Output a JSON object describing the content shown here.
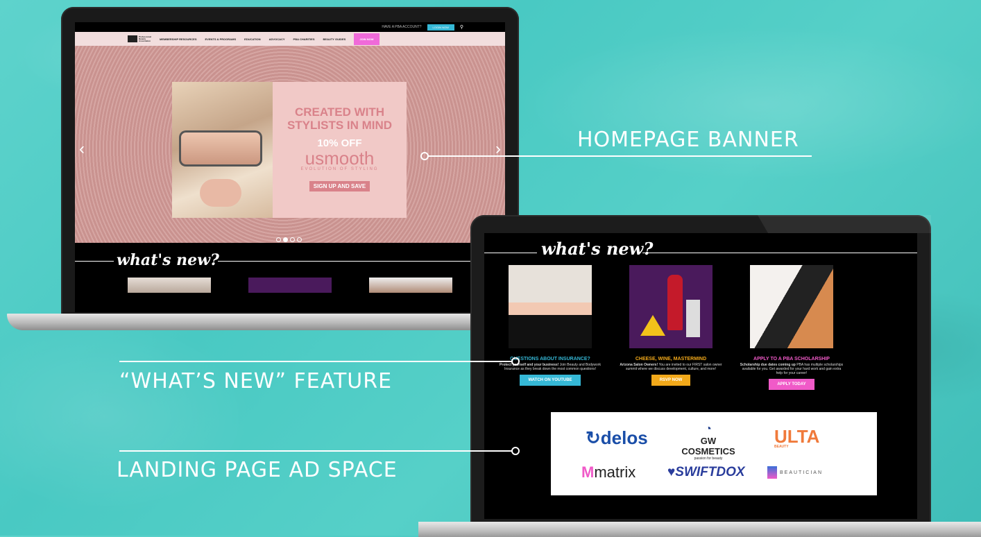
{
  "callouts": {
    "homepage_banner": "HOMEPAGE BANNER",
    "whats_new": "“WHAT’S NEW” FEATURE",
    "ad_space": "LANDING PAGE AD SPACE"
  },
  "site": {
    "topbar": {
      "account_text": "HAVE A PBA ACCOUNT?",
      "login": "LOGIN NOW"
    },
    "logo_text": "Professional Beauty Association",
    "nav": [
      "MEMBERSHIP RESOURCES",
      "EVENTS & PROGRAMS",
      "EDUCATION",
      "ADVOCACY",
      "PBA CHARITIES",
      "BEAUTY GUIDES"
    ],
    "join": "JOIN NOW",
    "banner": {
      "headline1": "CREATED WITH",
      "headline2": "STYLISTS IN MIND",
      "discount": "10% OFF",
      "brand": "usmooth",
      "tagline": "EVOLUTION OF STYLING",
      "cta": "SIGN UP AND SAVE"
    },
    "whats_new_title": "what's new?"
  },
  "cards": [
    {
      "heading": "QUESTIONS ABOUT INSURANCE?",
      "body_bold": "Protect yourself and your business!",
      "body": "Join Beauty and Bodywork Insurance as they break down the most common questions!",
      "button": "WATCH ON YOUTUBE",
      "color": "#35b8d6"
    },
    {
      "heading": "CHEESE, WINE, MASTERMIND",
      "body_bold": "Arizona Salon Owners!",
      "body": "You are invited to our FIRST salon owner summit where we discuss development, culture, and more!",
      "button": "RSVP NOW",
      "color": "#f2a91a"
    },
    {
      "heading": "APPLY TO A PBA SCHOLARSHIP",
      "body_bold": "Scholarship due dates coming up",
      "body": "PBA has multiple scholarships available for you. Get awarded for your hard work and gain extra help for your career!",
      "button": "APPLY TODAY",
      "color": "#f05ac8"
    }
  ],
  "ads": {
    "delos": "delos",
    "gw": "GW COSMETICS",
    "gw_sub": "passion for beauty",
    "ulta": "ULTA",
    "ulta_sub": "BEAUTY",
    "matrix": "matrix",
    "swiftdox": "SWIFTDOX",
    "beautician": "BEAUTICIAN"
  }
}
